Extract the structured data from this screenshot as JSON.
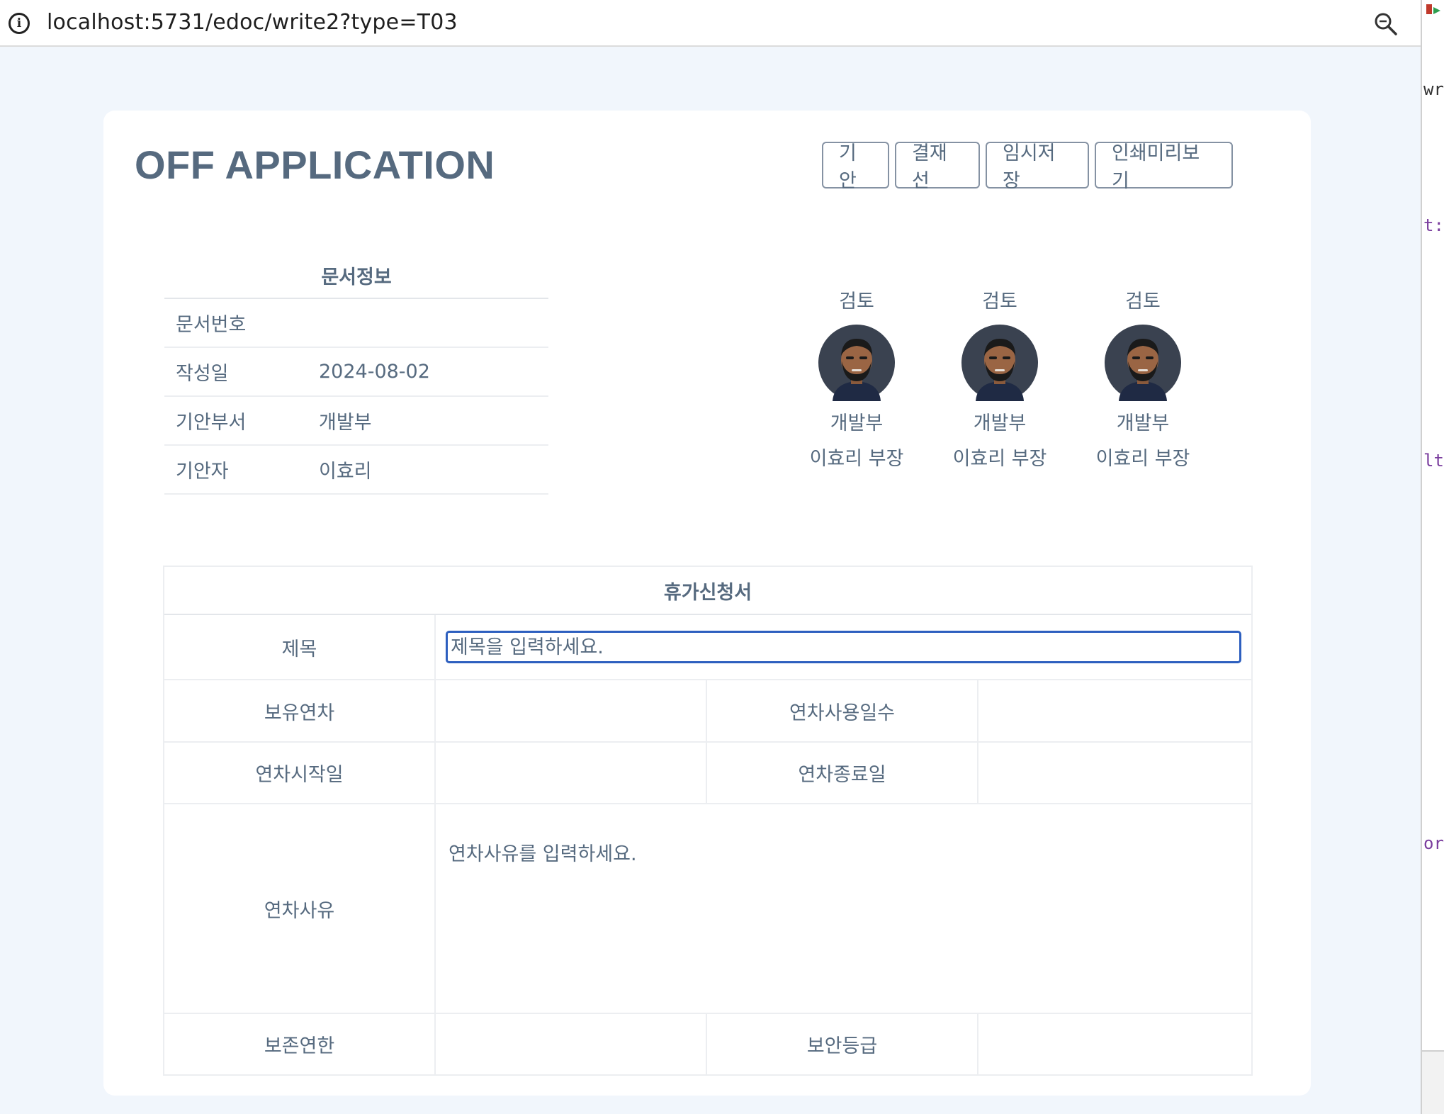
{
  "browser": {
    "url": "localhost:5731/edoc/write2?type=T03"
  },
  "side_strip": {
    "fragments": [
      "writ",
      "t:",
      "lth",
      "or:"
    ]
  },
  "page": {
    "title": "OFF APPLICATION",
    "buttons": {
      "submit": "기안",
      "approval_line": "결재선",
      "temp_save": "임시저장",
      "print_preview": "인쇄미리보기"
    }
  },
  "doc_info": {
    "title": "문서정보",
    "rows": [
      {
        "label": "문서번호",
        "value": ""
      },
      {
        "label": "작성일",
        "value": "2024-08-02"
      },
      {
        "label": "기안부서",
        "value": "개발부"
      },
      {
        "label": "기안자",
        "value": "이효리"
      }
    ]
  },
  "approvers": [
    {
      "role": "검토",
      "dept": "개발부",
      "name": "이효리 부장",
      "avatar_icon": "bearded-man-avatar-icon"
    },
    {
      "role": "검토",
      "dept": "개발부",
      "name": "이효리 부장",
      "avatar_icon": "bearded-man-avatar-icon"
    },
    {
      "role": "검토",
      "dept": "개발부",
      "name": "이효리 부장",
      "avatar_icon": "bearded-man-avatar-icon"
    }
  ],
  "form": {
    "title": "휴가신청서",
    "subject_label": "제목",
    "subject_placeholder": "제목을 입력하세요.",
    "remaining_leave_label": "보유연차",
    "remaining_leave_value": "",
    "leave_days_label": "연차사용일수",
    "leave_days_value": "",
    "start_date_label": "연차시작일",
    "start_date_value": "",
    "end_date_label": "연차종료일",
    "end_date_value": "",
    "reason_label": "연차사유",
    "reason_placeholder": "연차사유를 입력하세요.",
    "retention_label": "보존연한",
    "retention_value": "",
    "security_label": "보안등급",
    "security_value": ""
  },
  "colors": {
    "background": "#f1f6fc",
    "text": "#566a7f",
    "focus_border": "#2d5fbf"
  }
}
